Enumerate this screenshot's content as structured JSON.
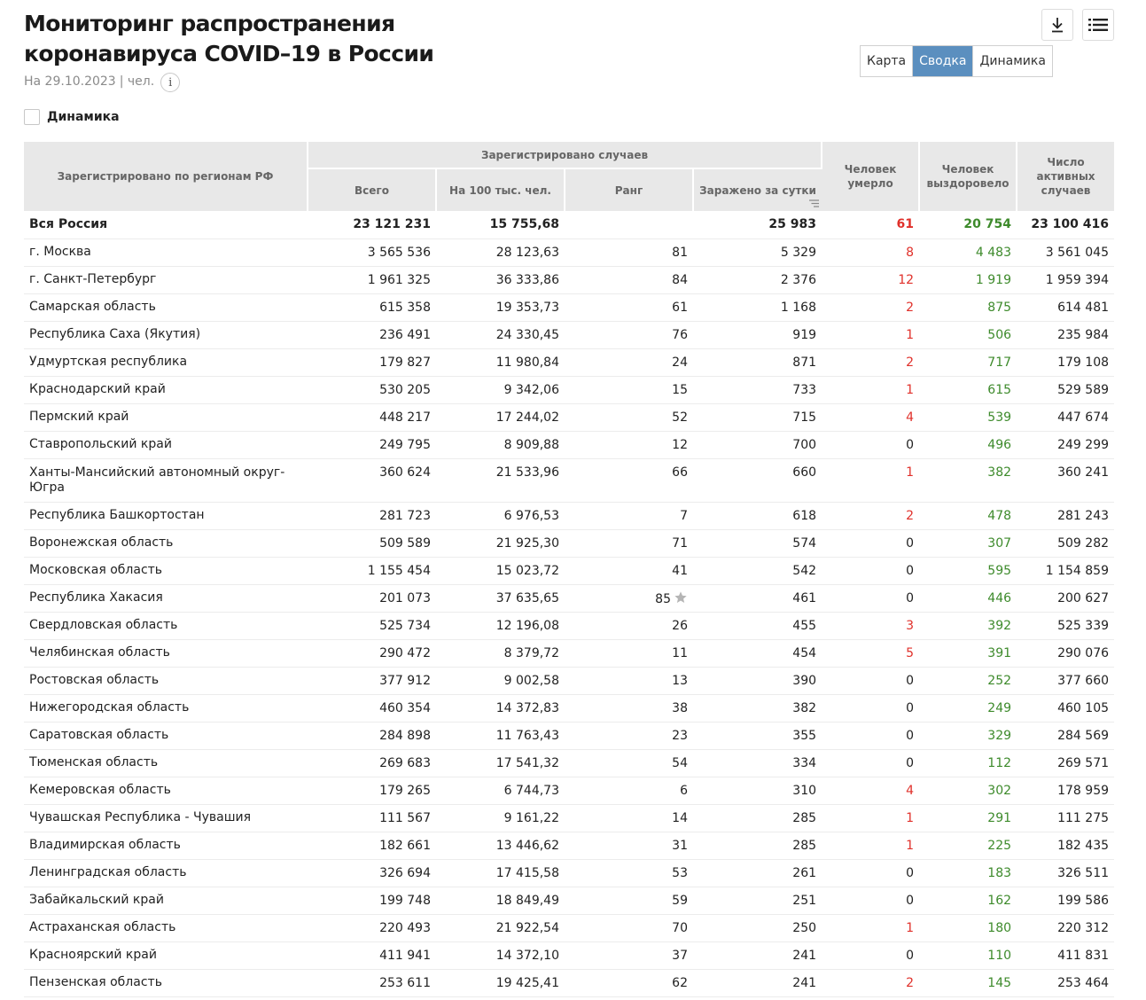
{
  "header": {
    "title": "Мониторинг распространения коронавируса COVID–19 в России",
    "date": "На 29.10.2023",
    "unit": "| чел.",
    "info_glyph": "i"
  },
  "tabs": [
    {
      "label": "Карта",
      "active": false
    },
    {
      "label": "Сводка",
      "active": true
    },
    {
      "label": "Динамика",
      "active": false
    }
  ],
  "toolbar": {
    "download_icon": "download-icon",
    "menu_icon": "menu-icon"
  },
  "dynamics_checkbox": {
    "label": "Динамика",
    "checked": false
  },
  "colors": {
    "accent": "#5b8fbf",
    "died": "#e0302a",
    "recovered": "#3d8a2b",
    "header_bg": "#e8e8e8"
  },
  "table": {
    "headers": {
      "region": "Зарегистрировано по регионам РФ",
      "registered_group": "Зарегистрировано случаев",
      "total": "Всего",
      "per100k": "На 100 тыс. чел.",
      "rank": "Ранг",
      "daily": "Заражено за сутки",
      "died": "Человек умерло",
      "recovered": "Человек выздоровело",
      "active": "Число активных случаев"
    },
    "total_row": {
      "region": "Вся Россия",
      "total": "23 121 231",
      "per100k": "15 755,68",
      "rank": "",
      "daily": "25 983",
      "died": "61",
      "recovered": "20 754",
      "active": "23 100 416"
    },
    "rows": [
      {
        "region": "г. Москва",
        "total": "3 565 536",
        "per100k": "28 123,63",
        "rank": "81",
        "daily": "5 329",
        "died": "8",
        "recovered": "4 483",
        "active": "3 561 045"
      },
      {
        "region": "г. Санкт-Петербург",
        "total": "1 961 325",
        "per100k": "36 333,86",
        "rank": "84",
        "daily": "2 376",
        "died": "12",
        "recovered": "1 919",
        "active": "1 959 394"
      },
      {
        "region": "Самарская область",
        "total": "615 358",
        "per100k": "19 353,73",
        "rank": "61",
        "daily": "1 168",
        "died": "2",
        "recovered": "875",
        "active": "614 481"
      },
      {
        "region": "Республика Саха (Якутия)",
        "total": "236 491",
        "per100k": "24 330,45",
        "rank": "76",
        "daily": "919",
        "died": "1",
        "recovered": "506",
        "active": "235 984"
      },
      {
        "region": "Удмуртская республика",
        "total": "179 827",
        "per100k": "11 980,84",
        "rank": "24",
        "daily": "871",
        "died": "2",
        "recovered": "717",
        "active": "179 108"
      },
      {
        "region": "Краснодарский край",
        "total": "530 205",
        "per100k": "9 342,06",
        "rank": "15",
        "daily": "733",
        "died": "1",
        "recovered": "615",
        "active": "529 589"
      },
      {
        "region": "Пермский край",
        "total": "448 217",
        "per100k": "17 244,02",
        "rank": "52",
        "daily": "715",
        "died": "4",
        "recovered": "539",
        "active": "447 674"
      },
      {
        "region": "Ставропольский край",
        "total": "249 795",
        "per100k": "8 909,88",
        "rank": "12",
        "daily": "700",
        "died": "0",
        "recovered": "496",
        "active": "249 299"
      },
      {
        "region": "Ханты-Мансийский автономный округ-Югра",
        "total": "360 624",
        "per100k": "21 533,96",
        "rank": "66",
        "daily": "660",
        "died": "1",
        "recovered": "382",
        "active": "360 241"
      },
      {
        "region": "Республика Башкортостан",
        "total": "281 723",
        "per100k": "6 976,53",
        "rank": "7",
        "daily": "618",
        "died": "2",
        "recovered": "478",
        "active": "281 243"
      },
      {
        "region": "Воронежская область",
        "total": "509 589",
        "per100k": "21 925,30",
        "rank": "71",
        "daily": "574",
        "died": "0",
        "recovered": "307",
        "active": "509 282"
      },
      {
        "region": "Московская область",
        "total": "1 155 454",
        "per100k": "15 023,72",
        "rank": "41",
        "daily": "542",
        "died": "0",
        "recovered": "595",
        "active": "1 154 859"
      },
      {
        "region": "Республика Хакасия",
        "total": "201 073",
        "per100k": "37 635,65",
        "rank": "85",
        "star": true,
        "daily": "461",
        "died": "0",
        "recovered": "446",
        "active": "200 627"
      },
      {
        "region": "Свердловская область",
        "total": "525 734",
        "per100k": "12 196,08",
        "rank": "26",
        "daily": "455",
        "died": "3",
        "recovered": "392",
        "active": "525 339"
      },
      {
        "region": "Челябинская область",
        "total": "290 472",
        "per100k": "8 379,72",
        "rank": "11",
        "daily": "454",
        "died": "5",
        "recovered": "391",
        "active": "290 076"
      },
      {
        "region": "Ростовская область",
        "total": "377 912",
        "per100k": "9 002,58",
        "rank": "13",
        "daily": "390",
        "died": "0",
        "recovered": "252",
        "active": "377 660"
      },
      {
        "region": "Нижегородская область",
        "total": "460 354",
        "per100k": "14 372,83",
        "rank": "38",
        "daily": "382",
        "died": "0",
        "recovered": "249",
        "active": "460 105"
      },
      {
        "region": "Саратовская область",
        "total": "284 898",
        "per100k": "11 763,43",
        "rank": "23",
        "daily": "355",
        "died": "0",
        "recovered": "329",
        "active": "284 569"
      },
      {
        "region": "Тюменская область",
        "total": "269 683",
        "per100k": "17 541,32",
        "rank": "54",
        "daily": "334",
        "died": "0",
        "recovered": "112",
        "active": "269 571"
      },
      {
        "region": "Кемеровская область",
        "total": "179 265",
        "per100k": "6 744,73",
        "rank": "6",
        "daily": "310",
        "died": "4",
        "recovered": "302",
        "active": "178 959"
      },
      {
        "region": "Чувашская Республика - Чувашия",
        "total": "111 567",
        "per100k": "9 161,22",
        "rank": "14",
        "daily": "285",
        "died": "1",
        "recovered": "291",
        "active": "111 275"
      },
      {
        "region": "Владимирская область",
        "total": "182 661",
        "per100k": "13 446,62",
        "rank": "31",
        "daily": "285",
        "died": "1",
        "recovered": "225",
        "active": "182 435"
      },
      {
        "region": "Ленинградская область",
        "total": "326 694",
        "per100k": "17 415,58",
        "rank": "53",
        "daily": "261",
        "died": "0",
        "recovered": "183",
        "active": "326 511"
      },
      {
        "region": "Забайкальский край",
        "total": "199 748",
        "per100k": "18 849,49",
        "rank": "59",
        "daily": "251",
        "died": "0",
        "recovered": "162",
        "active": "199 586"
      },
      {
        "region": "Астраханская область",
        "total": "220 493",
        "per100k": "21 922,54",
        "rank": "70",
        "daily": "250",
        "died": "1",
        "recovered": "180",
        "active": "220 312"
      },
      {
        "region": "Красноярский край",
        "total": "411 941",
        "per100k": "14 372,10",
        "rank": "37",
        "daily": "241",
        "died": "0",
        "recovered": "110",
        "active": "411 831"
      },
      {
        "region": "Пензенская область",
        "total": "253 611",
        "per100k": "19 425,41",
        "rank": "62",
        "daily": "241",
        "died": "2",
        "recovered": "145",
        "active": "253 464"
      }
    ]
  }
}
